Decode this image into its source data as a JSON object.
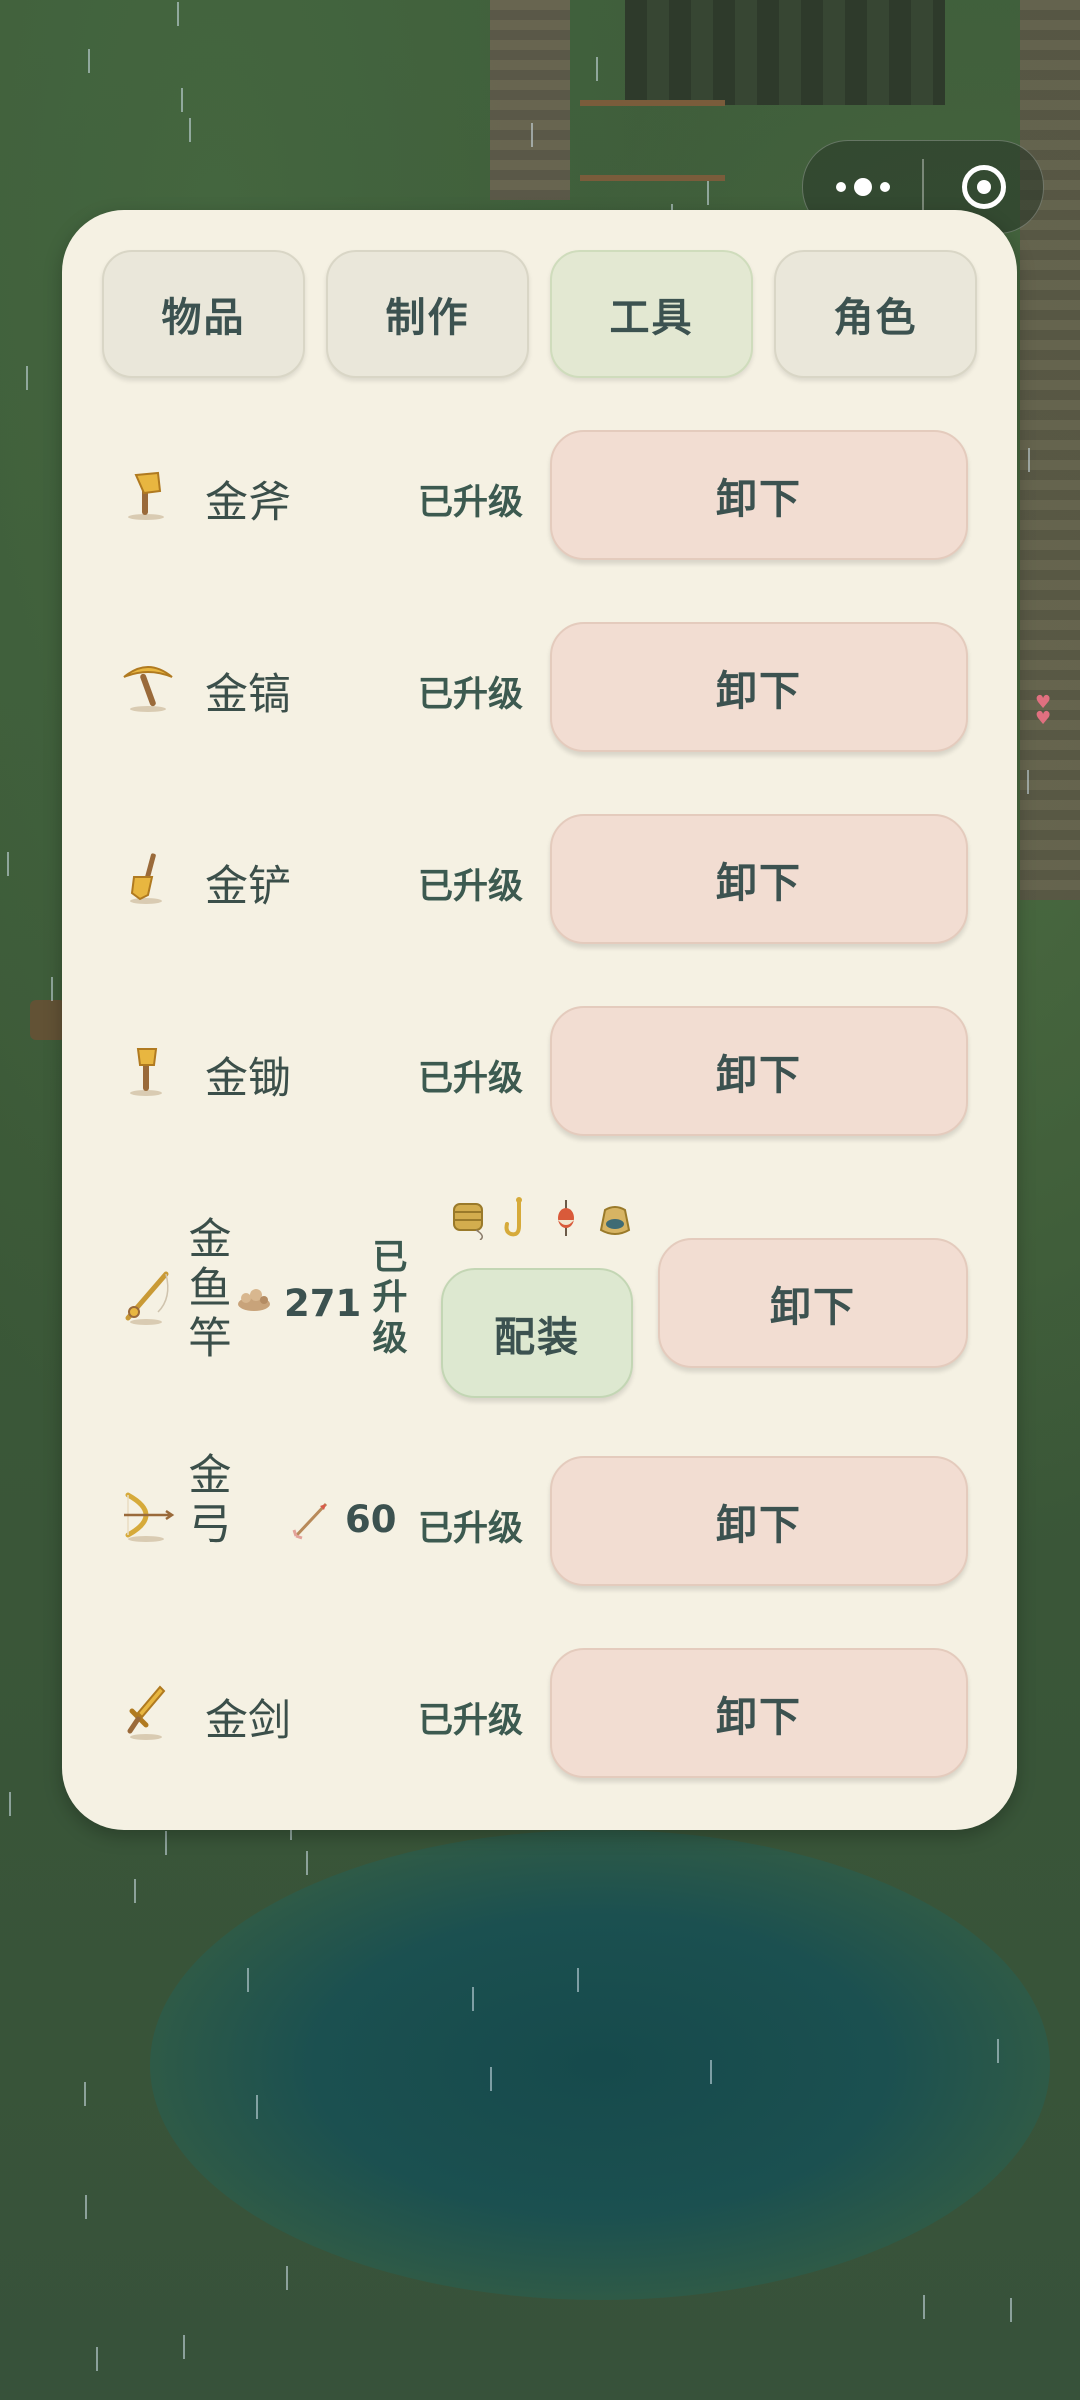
{
  "tabs": [
    {
      "label": "物品",
      "active": false
    },
    {
      "label": "制作",
      "active": false
    },
    {
      "label": "工具",
      "active": true
    },
    {
      "label": "角色",
      "active": false
    }
  ],
  "tools": [
    {
      "icon": "golden-axe-icon",
      "name": "金斧",
      "status": "已升级",
      "action": "卸下"
    },
    {
      "icon": "golden-pickaxe-icon",
      "name": "金镐",
      "status": "已升级",
      "action": "卸下"
    },
    {
      "icon": "golden-shovel-icon",
      "name": "金铲",
      "status": "已升级",
      "action": "卸下"
    },
    {
      "icon": "golden-hoe-icon",
      "name": "金锄",
      "status": "已升级",
      "action": "卸下"
    },
    {
      "icon": "golden-fishing-rod-icon",
      "name_chars": [
        "金",
        "鱼",
        "竿"
      ],
      "bait_icon": "bait-icon",
      "bait_count": "271",
      "status_chars": [
        "已",
        "升",
        "级"
      ],
      "equip_label": "配装",
      "equip_slots": [
        "fishing-line-icon",
        "fish-hook-icon",
        "fishing-float-icon",
        "bait-bag-icon"
      ],
      "action": "卸下"
    },
    {
      "icon": "golden-bow-icon",
      "name_chars": [
        "金",
        "弓"
      ],
      "arrow_icon": "arrow-icon",
      "arrow_count": "60",
      "status": "已升级",
      "action": "卸下"
    },
    {
      "icon": "golden-sword-icon",
      "name": "金剑",
      "status": "已升级",
      "action": "卸下"
    }
  ],
  "colors": {
    "panel": "#f5f1e3",
    "unload_button": "#f2ddd2",
    "equip_button": "#dde8d0",
    "tab_active": "#e3e8d2",
    "text": "#3c5250"
  }
}
